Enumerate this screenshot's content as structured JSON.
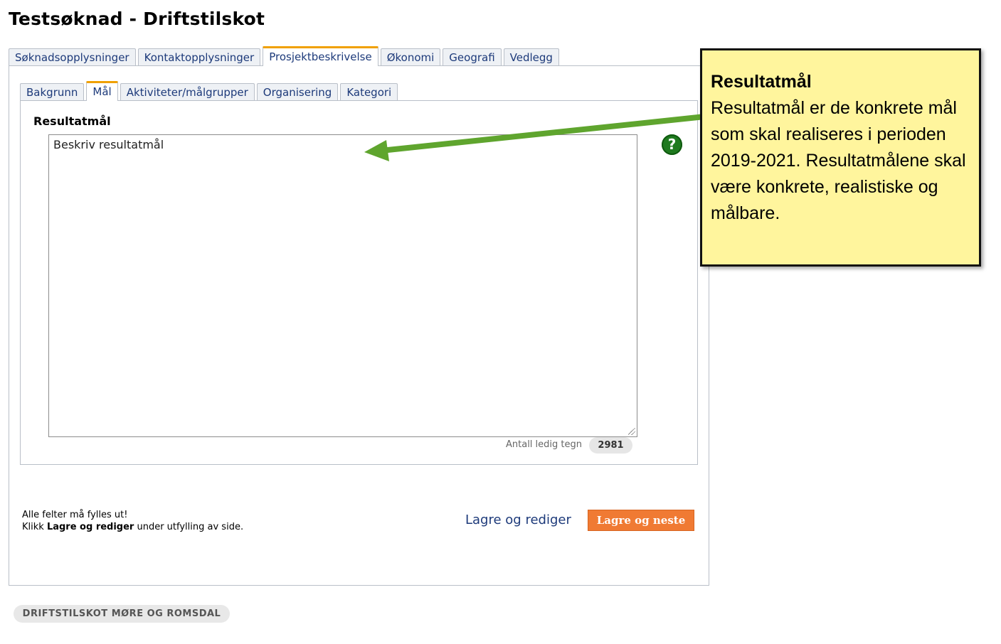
{
  "page": {
    "title": "Testsøknad - Driftstilskot"
  },
  "main_tabs": [
    {
      "label": "Søknadsopplysninger",
      "active": false
    },
    {
      "label": "Kontaktopplysninger",
      "active": false
    },
    {
      "label": "Prosjektbeskrivelse",
      "active": true
    },
    {
      "label": "Økonomi",
      "active": false
    },
    {
      "label": "Geografi",
      "active": false
    },
    {
      "label": "Vedlegg",
      "active": false
    }
  ],
  "sub_tabs": [
    {
      "label": "Bakgrunn",
      "active": false
    },
    {
      "label": "Mål",
      "active": true
    },
    {
      "label": "Aktiviteter/målgrupper",
      "active": false
    },
    {
      "label": "Organisering",
      "active": false
    },
    {
      "label": "Kategori",
      "active": false
    }
  ],
  "form": {
    "field_label": "Resultatmål",
    "textarea_value": "Beskriv resultatmål",
    "counter_label": "Antall ledig tegn",
    "counter_value": "2981",
    "help_icon_glyph": "?"
  },
  "footer_note": {
    "line1": "Alle felter må fylles ut!",
    "line2_prefix": "Klikk ",
    "line2_bold": "Lagre og rediger",
    "line2_suffix": " under utfylling av side."
  },
  "actions": {
    "save_edit_label": "Lagre og rediger",
    "save_next_label": "Lagre og neste"
  },
  "footer_badge": "DRIFTSTILSKOT MØRE OG ROMSDAL",
  "callout": {
    "title": "Resultatmål",
    "text": "Resultatmål er de konkrete mål som skal realiseres i perioden 2019-2021. Resultatmålene skal være konkrete, realistiske og målbare."
  },
  "colors": {
    "active_tab_accent": "#f0a000",
    "primary_button": "#f07a33",
    "link": "#1d3a7a",
    "help_icon": "#1f7a1f",
    "callout_bg": "#fff59d",
    "arrow": "#5fa52e"
  }
}
